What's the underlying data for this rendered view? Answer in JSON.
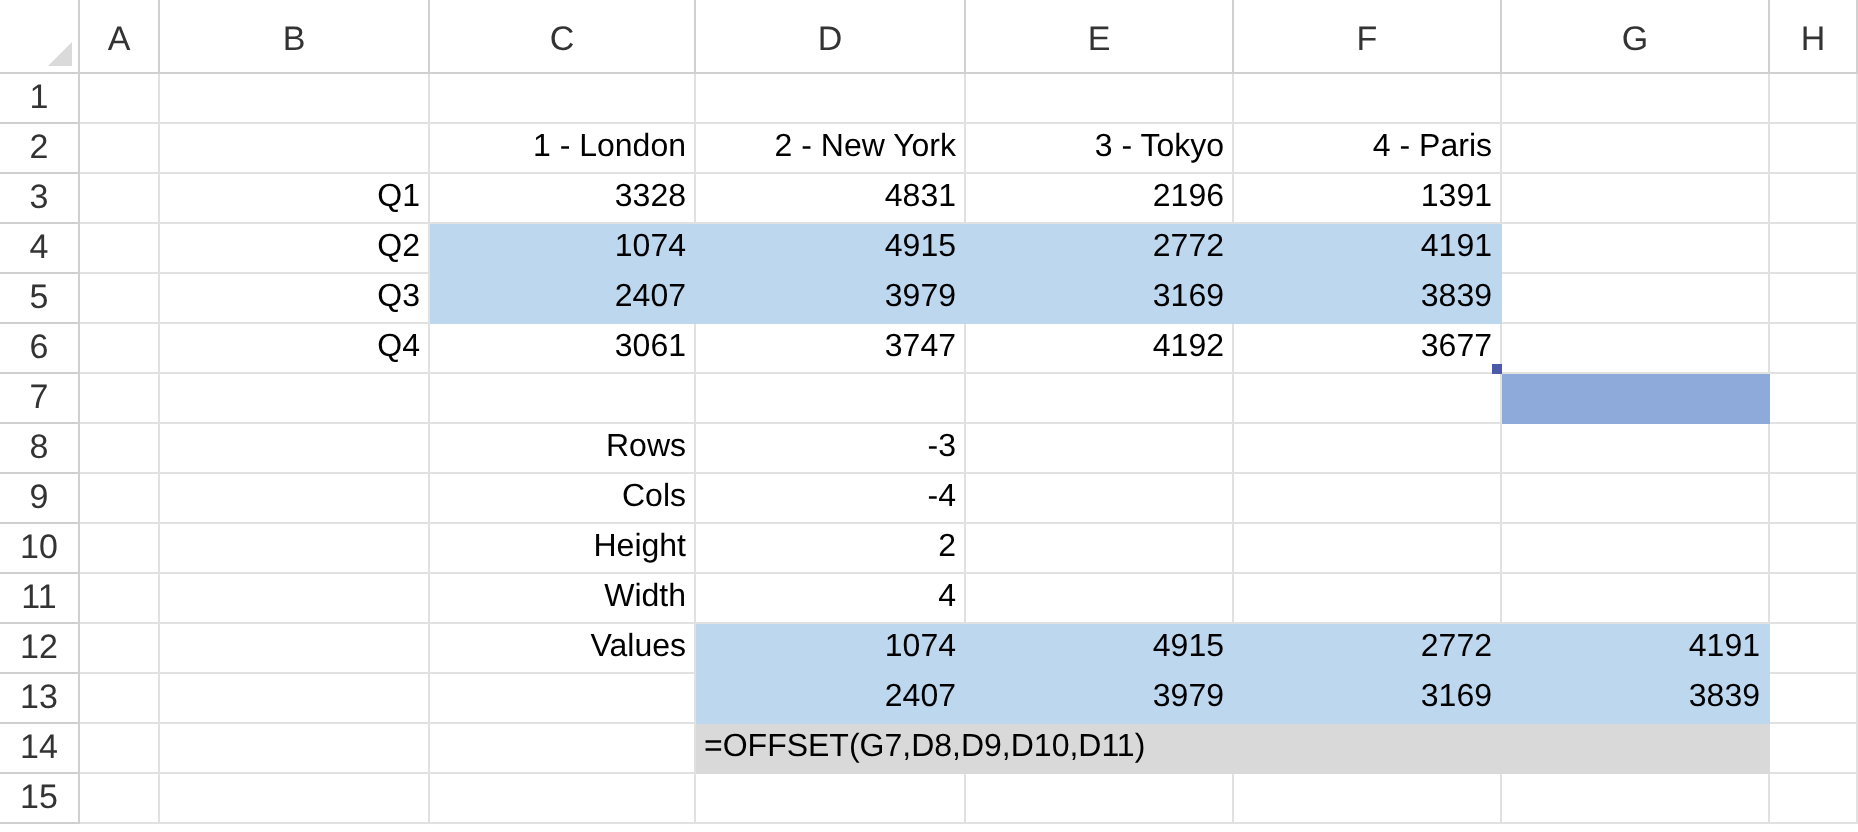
{
  "columns": [
    "A",
    "B",
    "C",
    "D",
    "E",
    "F",
    "G",
    "H"
  ],
  "rows": [
    {
      "header": "1",
      "cells": [
        {},
        {},
        {},
        {},
        {},
        {},
        {},
        {}
      ]
    },
    {
      "header": "2",
      "cells": [
        {},
        {},
        {
          "text": "1 - London"
        },
        {
          "text": "2 - New York"
        },
        {
          "text": "3 - Tokyo"
        },
        {
          "text": "4 - Paris"
        },
        {},
        {}
      ]
    },
    {
      "header": "3",
      "cells": [
        {},
        {
          "text": "Q1"
        },
        {
          "text": "3328"
        },
        {
          "text": "4831"
        },
        {
          "text": "2196"
        },
        {
          "text": "1391"
        },
        {},
        {}
      ]
    },
    {
      "header": "4",
      "cells": [
        {},
        {
          "text": "Q2"
        },
        {
          "text": "1074",
          "color": "#bdd7ee"
        },
        {
          "text": "4915",
          "color": "#bdd7ee"
        },
        {
          "text": "2772",
          "color": "#bdd7ee"
        },
        {
          "text": "4191",
          "color": "#bdd7ee"
        },
        {},
        {}
      ]
    },
    {
      "header": "5",
      "cells": [
        {},
        {
          "text": "Q3"
        },
        {
          "text": "2407",
          "color": "#bdd7ee"
        },
        {
          "text": "3979",
          "color": "#bdd7ee"
        },
        {
          "text": "3169",
          "color": "#bdd7ee"
        },
        {
          "text": "3839",
          "color": "#bdd7ee"
        },
        {},
        {}
      ]
    },
    {
      "header": "6",
      "cells": [
        {},
        {
          "text": "Q4"
        },
        {
          "text": "3061"
        },
        {
          "text": "3747"
        },
        {
          "text": "4192"
        },
        {
          "text": "3677",
          "fill_handle": true
        },
        {},
        {}
      ]
    },
    {
      "header": "7",
      "cells": [
        {},
        {},
        {},
        {},
        {},
        {},
        {
          "color": "#8eaadb"
        },
        {}
      ]
    },
    {
      "header": "8",
      "cells": [
        {},
        {},
        {
          "text": "Rows"
        },
        {
          "text": "-3"
        },
        {},
        {},
        {},
        {}
      ]
    },
    {
      "header": "9",
      "cells": [
        {},
        {},
        {
          "text": "Cols"
        },
        {
          "text": "-4"
        },
        {},
        {},
        {},
        {}
      ]
    },
    {
      "header": "10",
      "cells": [
        {},
        {},
        {
          "text": "Height"
        },
        {
          "text": "2"
        },
        {},
        {},
        {},
        {}
      ]
    },
    {
      "header": "11",
      "cells": [
        {},
        {},
        {
          "text": "Width"
        },
        {
          "text": "4"
        },
        {},
        {},
        {},
        {}
      ]
    },
    {
      "header": "12",
      "cells": [
        {},
        {},
        {
          "text": "Values"
        },
        {
          "text": "1074",
          "color": "#bdd7ee"
        },
        {
          "text": "4915",
          "color": "#bdd7ee"
        },
        {
          "text": "2772",
          "color": "#bdd7ee"
        },
        {
          "text": "4191",
          "color": "#bdd7ee"
        },
        {}
      ]
    },
    {
      "header": "13",
      "cells": [
        {},
        {},
        {},
        {
          "text": "2407",
          "color": "#bdd7ee"
        },
        {
          "text": "3979",
          "color": "#bdd7ee"
        },
        {
          "text": "3169",
          "color": "#bdd7ee"
        },
        {
          "text": "3839",
          "color": "#bdd7ee"
        },
        {}
      ]
    },
    {
      "header": "14",
      "cells": [
        {},
        {},
        {},
        {
          "text": "=OFFSET(G7,D8,D9,D10,D11)",
          "color": "#d9d9d9",
          "kind": "formula"
        },
        {
          "color": "#d9d9d9"
        },
        {
          "color": "#d9d9d9"
        },
        {
          "color": "#d9d9d9"
        },
        {}
      ]
    },
    {
      "header": "15",
      "cells": [
        {},
        {},
        {},
        {},
        {},
        {},
        {},
        {}
      ]
    }
  ]
}
